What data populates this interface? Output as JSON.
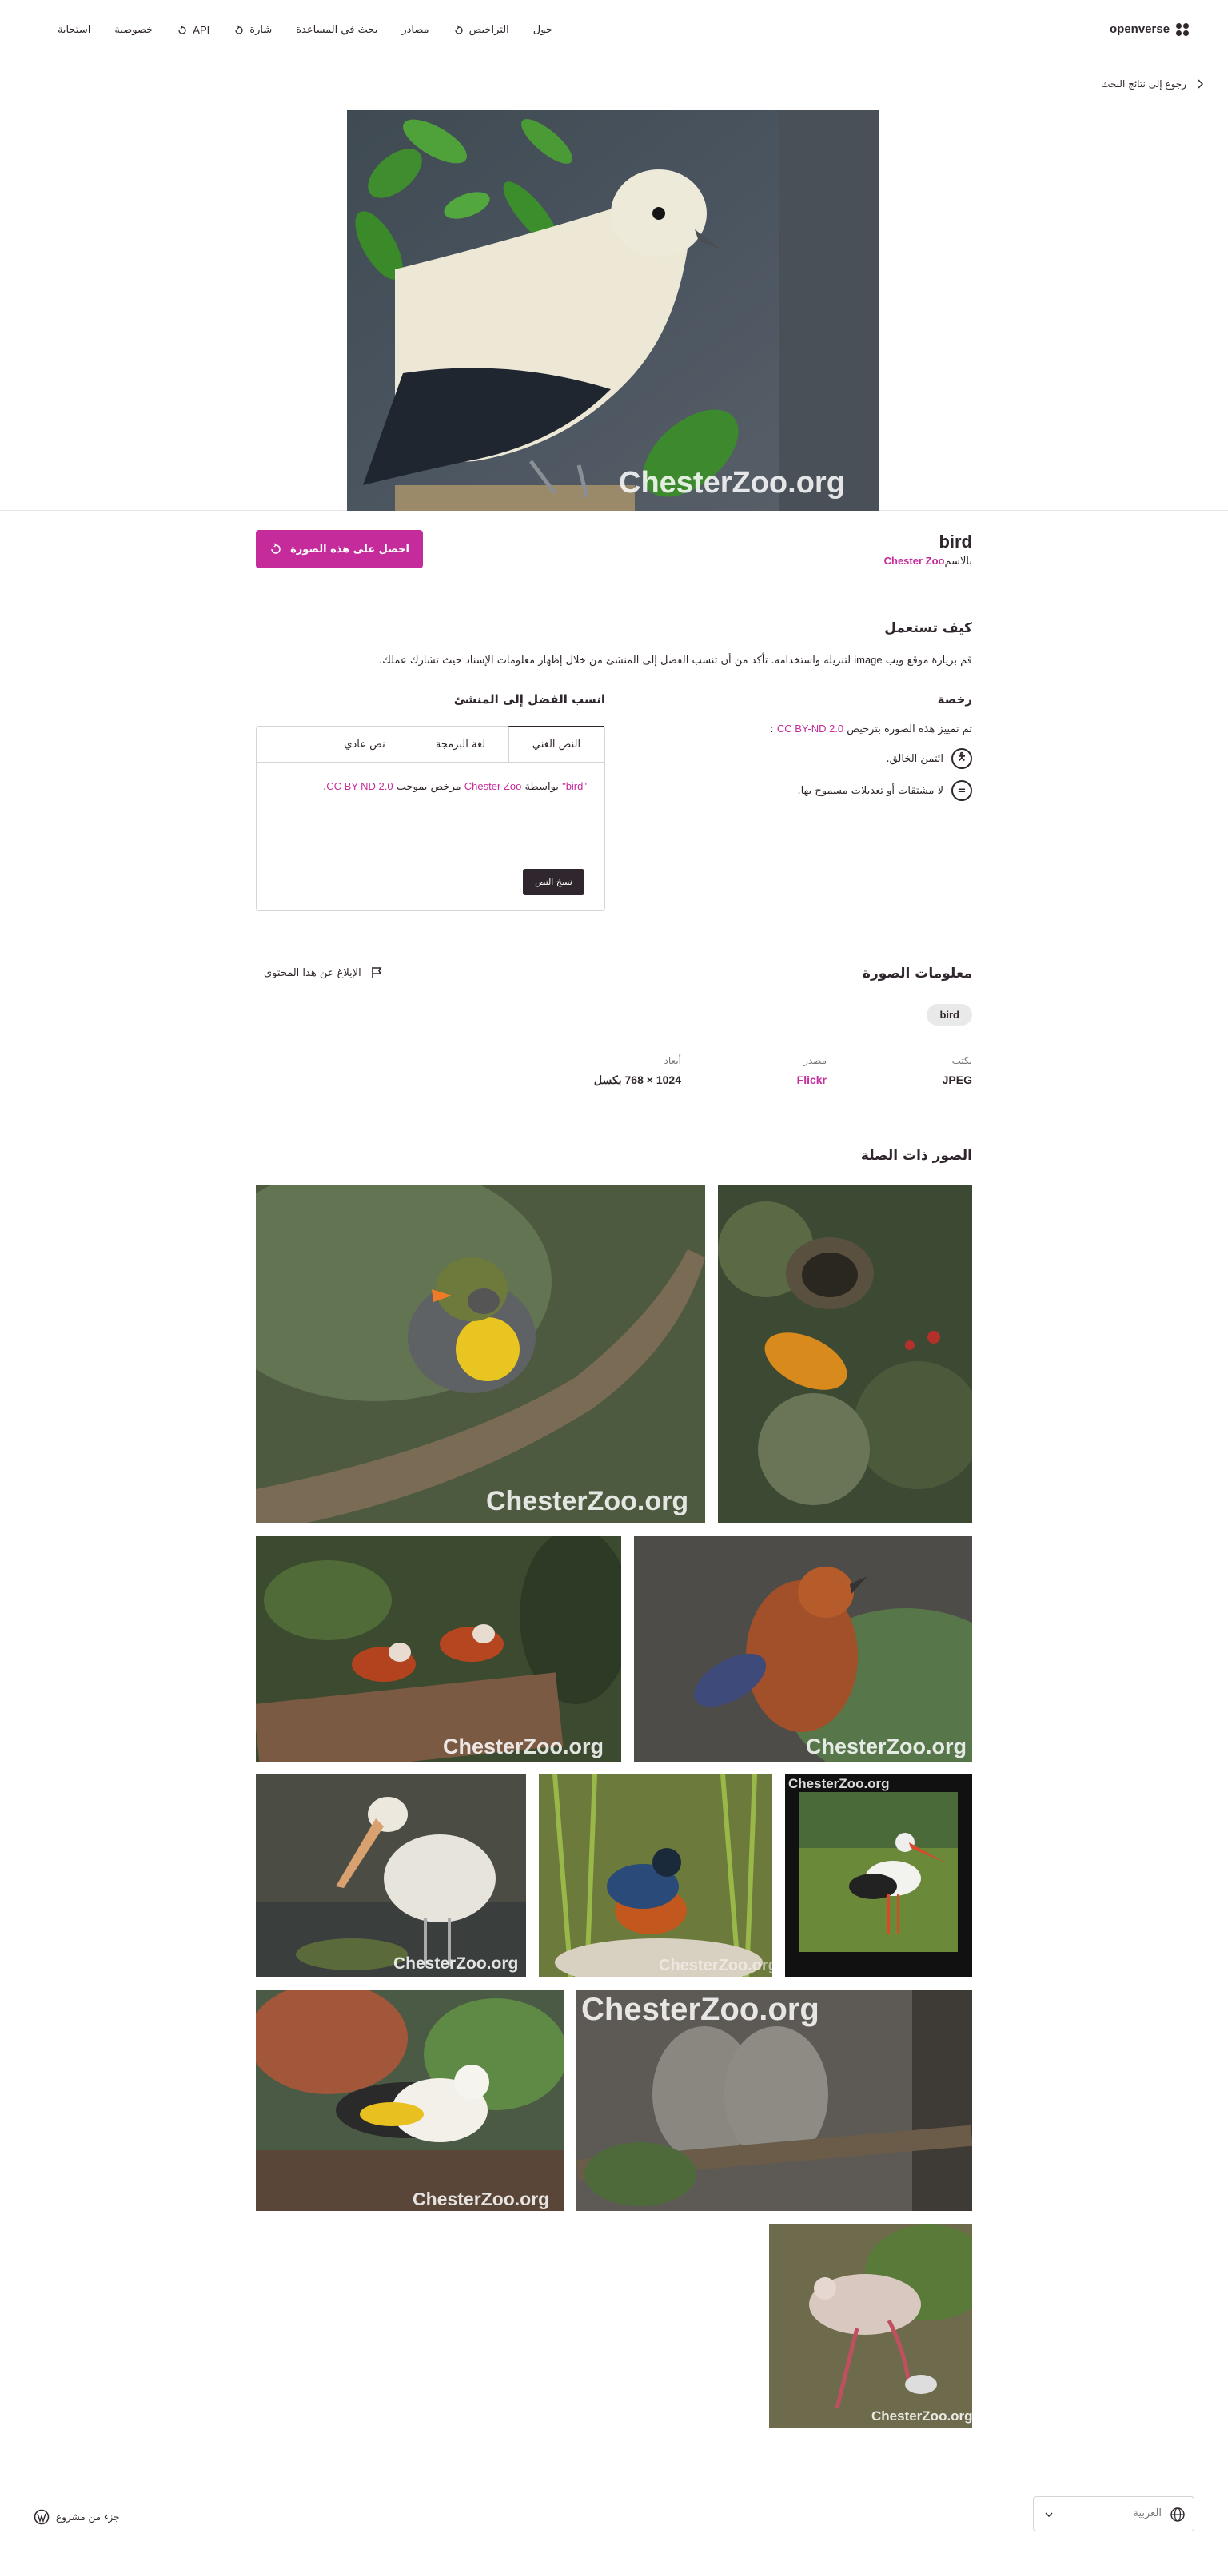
{
  "header": {
    "logo_text": "openverse",
    "nav": [
      {
        "label": "حول",
        "icon": ""
      },
      {
        "label": "التراخيص",
        "icon": "external-link-icon"
      },
      {
        "label": "مصادر",
        "icon": ""
      },
      {
        "label": "بحث في المساعدة",
        "icon": ""
      },
      {
        "label": "شارة",
        "icon": "external-link-icon"
      },
      {
        "label": "API",
        "icon": "external-link-icon"
      },
      {
        "label": "خصوصية",
        "icon": ""
      },
      {
        "label": "استجابة",
        "icon": ""
      }
    ]
  },
  "back_link": "رجوع إلى نتائج البحث",
  "image": {
    "title": "bird",
    "by_prefix": "بالاسم",
    "creator": "Chester Zoo",
    "get_button": "احصل على هذه الصورة",
    "watermark": "ChesterZoo.org"
  },
  "how_to_use": {
    "heading": "كيف تستعمل",
    "text_before": "قم بزيارة موقع ويب",
    "text_link": "image",
    "text_after": "لتنزيله واستخدامه. تأكد من أن تنسب الفضل إلى المنشئ من خلال إظهار معلومات الإسناد حيث تشارك عملك."
  },
  "license": {
    "heading": "رخصة",
    "marked_text": "تم تمييز هذه الصورة بترخيص",
    "license_link": "CC BY-ND 2.0",
    "license_suffix": ":",
    "items": [
      {
        "icon": "cc-by-icon",
        "symbol": "🄯",
        "text": "ائتمن الخالق."
      },
      {
        "icon": "cc-nd-icon",
        "symbol": "=",
        "text": "لا مشتقات أو تعديلات مسموح بها."
      }
    ]
  },
  "attribution": {
    "heading": "انسب الفضل إلى المنشئ",
    "tabs": [
      "النص الغني",
      "لغة البرمجة",
      "نص عادي"
    ],
    "title_quote": "\"bird\"",
    "by_word": " بواسطة ",
    "creator": "Chester Zoo",
    "licensed_word": " مرخص بموجب ",
    "license": "CC BY-ND 2.0",
    "end": ".",
    "copy_button": "نسخ النص"
  },
  "image_info": {
    "heading": "معلومات الصورة",
    "report": "الإبلاغ عن هذا المحتوى",
    "tag": "bird",
    "fields": [
      {
        "key": "يكتب",
        "value": "JPEG"
      },
      {
        "key": "مصدر",
        "value": "Flickr"
      },
      {
        "key": "أبعاد",
        "value": "1024 × 768 بكسل"
      }
    ]
  },
  "related": {
    "heading": "الصور ذات الصلة",
    "watermark": "ChesterZoo.org"
  },
  "footer": {
    "part_of": "جزء من مشروع",
    "language": "العربية"
  },
  "colors": {
    "accent": "#c52b9b",
    "text": "#30272e"
  }
}
